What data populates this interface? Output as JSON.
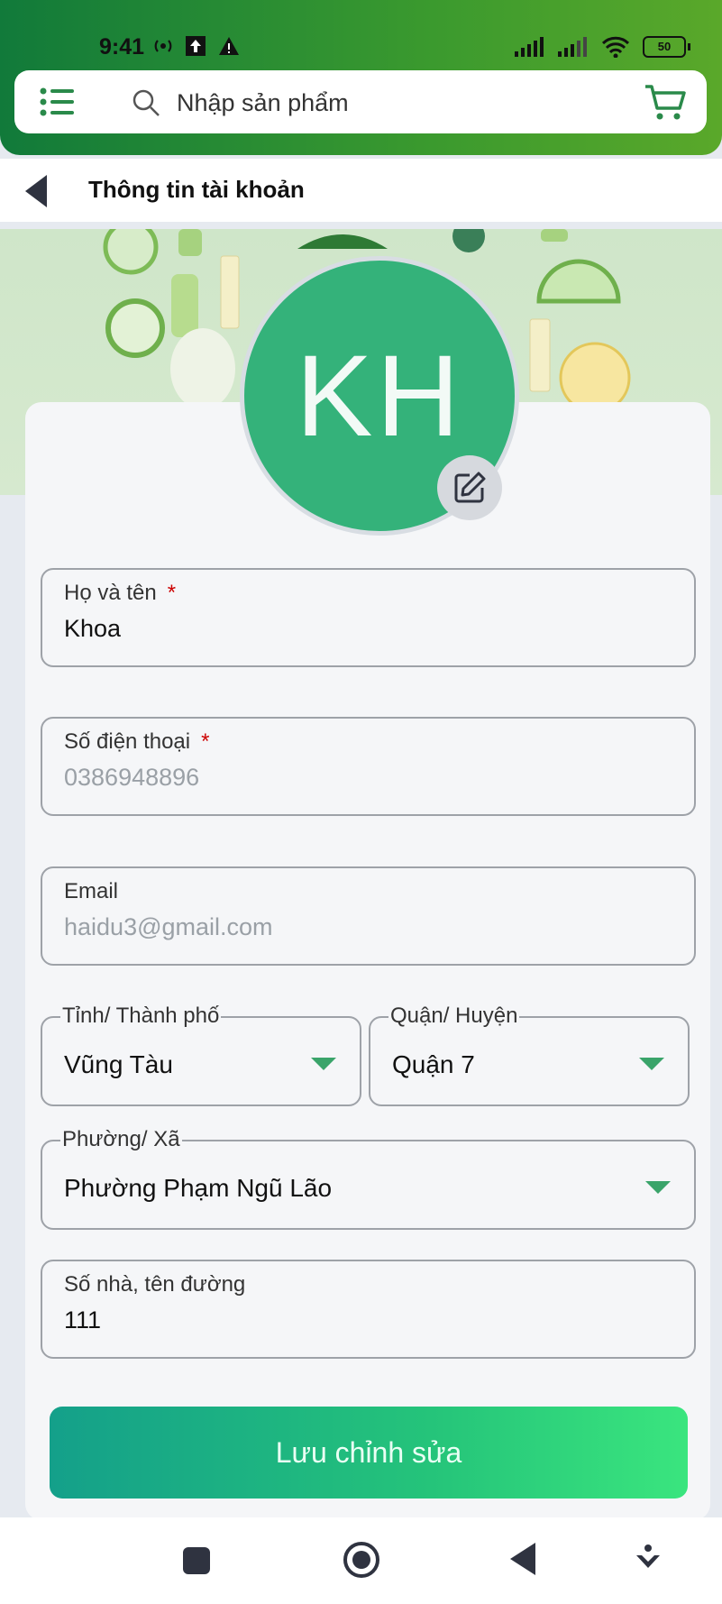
{
  "status_bar": {
    "time": "9:41",
    "battery": "50",
    "icons": [
      "hotspot-icon",
      "upload-icon",
      "warning-icon",
      "signal-icon",
      "signal-icon",
      "wifi-icon",
      "battery-icon"
    ]
  },
  "search": {
    "placeholder": "Nhập sản phẩm"
  },
  "page": {
    "title": "Thông tin tài khoản"
  },
  "avatar": {
    "initials": "KH"
  },
  "form": {
    "full_name": {
      "label": "Họ và tên",
      "required": "*",
      "value": "Khoa"
    },
    "phone": {
      "label": "Số điện thoại",
      "required": "*",
      "value": "0386948896"
    },
    "email": {
      "label": "Email",
      "value": "haidu3@gmail.com"
    },
    "province": {
      "label": "Tỉnh/ Thành phố",
      "value": "Vũng Tàu"
    },
    "district": {
      "label": "Quận/ Huyện",
      "value": "Quận 7"
    },
    "ward": {
      "label": "Phường/ Xã",
      "value": "Phường Phạm Ngũ Lão"
    },
    "address": {
      "label": "Số nhà, tên đường",
      "value": "111"
    }
  },
  "save_button": {
    "label": "Lưu chỉnh sửa"
  },
  "colors": {
    "accent": "#34b27a",
    "header_start": "#117a3a",
    "header_end": "#5aa82a",
    "required": "#cc0000"
  }
}
